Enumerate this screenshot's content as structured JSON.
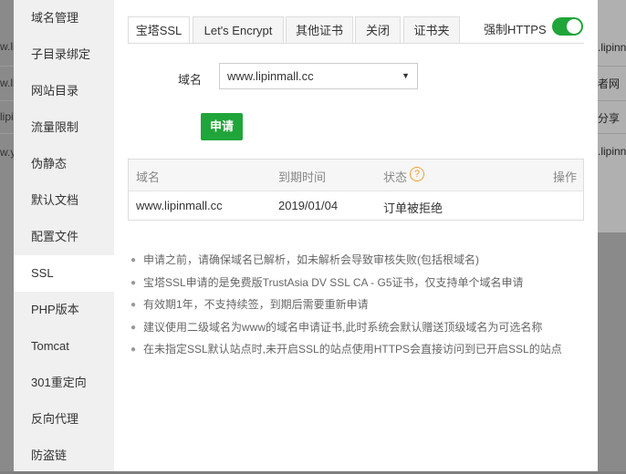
{
  "background": {
    "left_fragments": [
      "w.li",
      "w.li",
      "lipi",
      "w.y"
    ],
    "right_fragments": [
      ".lipinn",
      "者网",
      "分享",
      ".lipinn"
    ]
  },
  "sidebar": {
    "items": [
      {
        "label": "域名管理"
      },
      {
        "label": "子目录绑定"
      },
      {
        "label": "网站目录"
      },
      {
        "label": "流量限制"
      },
      {
        "label": "伪静态"
      },
      {
        "label": "默认文档"
      },
      {
        "label": "配置文件"
      },
      {
        "label": "SSL",
        "active": true
      },
      {
        "label": "PHP版本"
      },
      {
        "label": "Tomcat"
      },
      {
        "label": "301重定向"
      },
      {
        "label": "反向代理"
      },
      {
        "label": "防盗链"
      }
    ]
  },
  "tabs": [
    {
      "label": "宝塔SSL",
      "active": true
    },
    {
      "label": "Let's Encrypt"
    },
    {
      "label": "其他证书"
    },
    {
      "label": "关闭"
    },
    {
      "label": "证书夹"
    }
  ],
  "force_https": {
    "label": "强制HTTPS",
    "enabled": true,
    "color": "#20a53a"
  },
  "form": {
    "domain_label": "域名",
    "domain_value": "www.lipinmall.cc",
    "apply_label": "申请"
  },
  "table": {
    "headers": {
      "domain": "域名",
      "expiry": "到期时间",
      "status": "状态",
      "help": "?",
      "action": "操作"
    },
    "rows": [
      {
        "domain": "www.lipinmall.cc",
        "expiry": "2019/01/04",
        "status": "订单被拒绝"
      }
    ]
  },
  "notes": [
    "申请之前，请确保域名已解析，如未解析会导致审核失败(包括根域名)",
    "宝塔SSL申请的是免费版TrustAsia DV SSL CA - G5证书，仅支持单个域名申请",
    "有效期1年，不支持续签，到期后需要重新申请",
    "建议使用二级域名为www的域名申请证书,此时系统会默认赠送顶级域名为可选名称",
    "在未指定SSL默认站点时,未开启SSL的站点使用HTTPS会直接访问到已开启SSL的站点"
  ],
  "colors": {
    "accent": "#20a53a",
    "help": "#f0a030"
  }
}
